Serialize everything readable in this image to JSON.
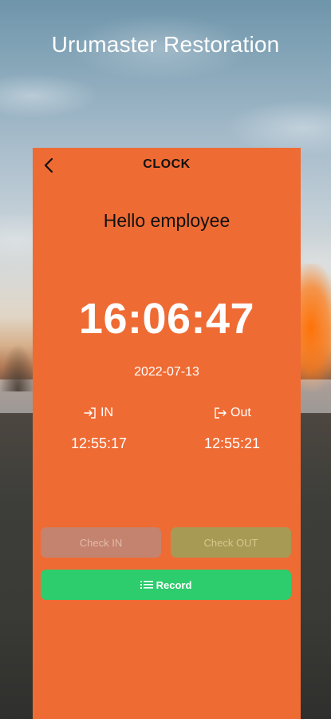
{
  "app": {
    "title": "Urumaster Restoration"
  },
  "header": {
    "title": "CLOCK",
    "back_icon": "chevron-left-icon"
  },
  "greeting": "Hello employee",
  "clock": {
    "time": "16:06:47",
    "date": "2022-07-13"
  },
  "in": {
    "label": "IN",
    "icon": "login-icon",
    "time": "12:55:17"
  },
  "out": {
    "label": "Out",
    "icon": "logout-icon",
    "time": "12:55:21"
  },
  "buttons": {
    "check_in": "Check IN",
    "check_out": "Check OUT",
    "record": "Record",
    "record_icon": "list-icon"
  },
  "colors": {
    "card": "#ef6b34",
    "check_in_button": "#c4836e",
    "check_out_button": "#a69a55",
    "record_button": "#2dcc6c"
  }
}
